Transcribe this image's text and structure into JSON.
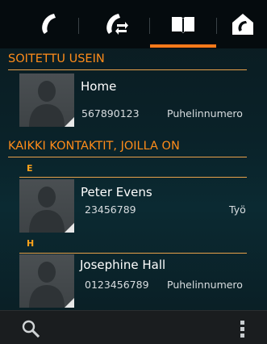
{
  "tabs": [
    {
      "name": "calls",
      "icon": "phone-icon",
      "selected": false
    },
    {
      "name": "call-transfer",
      "icon": "phone-transfer-icon",
      "selected": false
    },
    {
      "name": "phonebook",
      "icon": "book-icon",
      "selected": true
    },
    {
      "name": "home",
      "icon": "home-phone-icon",
      "selected": false
    }
  ],
  "sections": {
    "frequent_title": "SOITETTU USEIN",
    "all_title": "KAIKKI KONTAKTIT, JOILLA ON"
  },
  "frequent": [
    {
      "name": "Home",
      "number": "567890123",
      "type": "Puhelinnumero"
    }
  ],
  "groups": [
    {
      "letter": "E",
      "contacts": [
        {
          "name": "Peter Evens",
          "number": "23456789",
          "type": "Työ"
        }
      ]
    },
    {
      "letter": "H",
      "contacts": [
        {
          "name": "Josephine Hall",
          "number": "0123456789",
          "type": "Puhelinnumero"
        }
      ]
    }
  ],
  "colors": {
    "accent": "#ff7a1a",
    "section_text": "#ff8c1a",
    "background": "#0a2229"
  },
  "bottom_bar": {
    "search_icon": "search-icon",
    "menu_icon": "overflow-menu-icon"
  }
}
